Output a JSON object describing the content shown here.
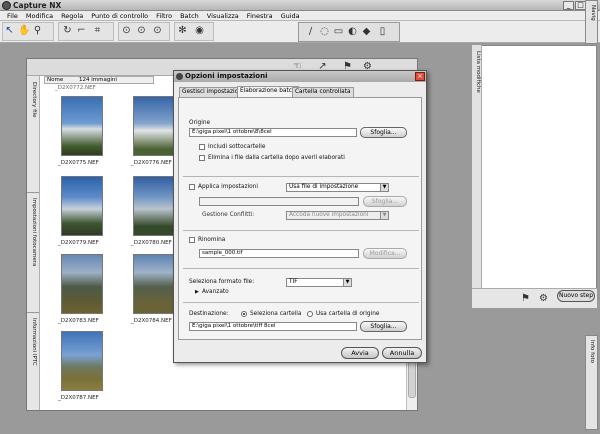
{
  "app": {
    "title": "Capture NX"
  },
  "menu": [
    "File",
    "Modifica",
    "Regola",
    "Punto di controllo",
    "Filtro",
    "Batch",
    "Visualizza",
    "Finestra",
    "Guida"
  ],
  "browser": {
    "sort_label": "Nome",
    "count_label": "124 immagini",
    "side_tabs": [
      "Directory file",
      "Impostazioni fotocamera",
      "Informazioni IPTC"
    ],
    "thumbnails": [
      "_D2X0775.NEF",
      "_D2X0776.NEF",
      "_D2X0779.NEF",
      "_D2X0780.NEF",
      "_D2X0783.NEF",
      "_D2X0784.NEF",
      "_D2X0787.NEF"
    ]
  },
  "right_panel": {
    "tab_label": "Lista modifiche",
    "next_step": "Nuovo step",
    "info_tab": "Info foto",
    "nav_tab": "Navig"
  },
  "dialog": {
    "title": "Opzioni impostazioni",
    "tabs": [
      "Gestisci impostazioni",
      "Elaborazione batch",
      "Cartella controllata"
    ],
    "origin": {
      "label": "Origine",
      "path": "E:\\giga pixel\\1 ottobre\\8\\8cel",
      "browse": "Sfoglia...",
      "include_subfolders": "Includi sottocartelle",
      "delete_after": "Elimina i file dalla cartella dopo averli elaborati"
    },
    "apply": {
      "label": "Applica impostazioni",
      "select_value": "Usa file di impostazione",
      "browse": "Sfoglia...",
      "conflict_label": "Gestione Conflitti:",
      "conflict_value": "Accoda nuove impostazioni"
    },
    "rename": {
      "label": "Rinomina",
      "value": "sample_000.tif",
      "modify": "Modifica..."
    },
    "format": {
      "label": "Seleziona formato file:",
      "value": "TIF",
      "advanced": "Avanzato"
    },
    "destination": {
      "label": "Destinazione:",
      "opt_select": "Seleziona cartella",
      "opt_origin": "Usa cartella di origine",
      "path": "E:\\giga pixel\\1 ottobre\\tiff 8cel",
      "browse": "Sfoglia..."
    },
    "start": "Avvia",
    "cancel": "Annulla"
  }
}
